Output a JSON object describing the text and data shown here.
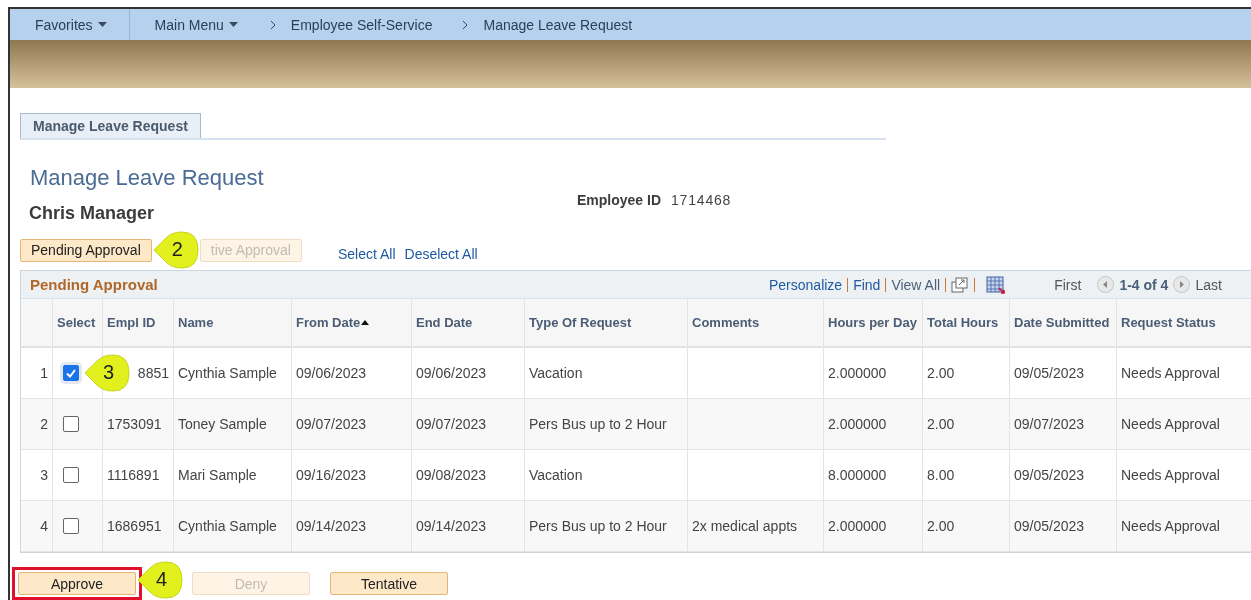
{
  "nav": {
    "items": [
      {
        "label": "Favorites",
        "kind": "menu"
      },
      {
        "label": "Main Menu",
        "kind": "menu"
      },
      {
        "label": "Employee Self-Service",
        "kind": "crumb"
      },
      {
        "label": "Manage Leave Request",
        "kind": "crumb"
      }
    ]
  },
  "page_tab": {
    "label": "Manage Leave Request",
    "selected": true
  },
  "title": "Manage Leave Request",
  "employee_name": "Chris Manager",
  "employee_id": {
    "label": "Employee ID",
    "value": "1714468"
  },
  "filter_buttons": [
    {
      "label": "Pending Approval",
      "blurred": false,
      "callout": "2"
    },
    {
      "label": "tive Approval",
      "blurred": true
    }
  ],
  "links": [
    "Select All",
    "Deselect All"
  ],
  "grid": {
    "title": "Pending Approval",
    "tools": [
      "Personalize",
      "Find",
      "View All"
    ],
    "first": "First",
    "range": "1-4 of 4",
    "last": "Last",
    "columns": [
      {},
      {
        "label": "Select"
      },
      {
        "label": "Empl ID"
      },
      {
        "label": "Name"
      },
      {
        "label": "From Date",
        "sorted": true
      },
      {
        "label": "End Date"
      },
      {
        "label": "Type Of Request"
      },
      {
        "label": "Comments"
      },
      {
        "label": "Hours per Day"
      },
      {
        "label": "Total Hours"
      },
      {
        "label": "Date Submitted"
      },
      {
        "label": "Request Status"
      }
    ],
    "rows": [
      {
        "selected": true,
        "callout": "3",
        "cells": [
          "1",
          "",
          "8851",
          "Cynthia Sample",
          "09/06/2023",
          "09/06/2023",
          "Vacation",
          "",
          "2.000000",
          "2.00",
          "09/05/2023",
          "Needs Approval"
        ]
      },
      {
        "selected": false,
        "cells": [
          "2",
          "",
          "1753091",
          "Toney Sample",
          "09/07/2023",
          "09/07/2023",
          "Pers Bus up to 2 Hour",
          "",
          "2.000000",
          "2.00",
          "09/07/2023",
          "Needs Approval"
        ]
      },
      {
        "selected": false,
        "cells": [
          "3",
          "",
          "1116891",
          "Mari Sample",
          "09/16/2023",
          "09/08/2023",
          "Vacation",
          "",
          "8.000000",
          "8.00",
          "09/05/2023",
          "Needs Approval"
        ]
      },
      {
        "selected": false,
        "cells": [
          "4",
          "",
          "1686951",
          "Cynthia Sample",
          "09/14/2023",
          "09/14/2023",
          "Pers Bus up to 2 Hour",
          "2x medical appts",
          "2.000000",
          "2.00",
          "09/05/2023",
          "Needs Approval"
        ]
      }
    ]
  },
  "actions": [
    {
      "label": "Approve",
      "blurred": false,
      "highlighted": true,
      "callout": "4"
    },
    {
      "label": "Deny",
      "blurred": true,
      "highlighted": false
    },
    {
      "label": "Tentative",
      "blurred": false,
      "highlighted": false
    }
  ]
}
